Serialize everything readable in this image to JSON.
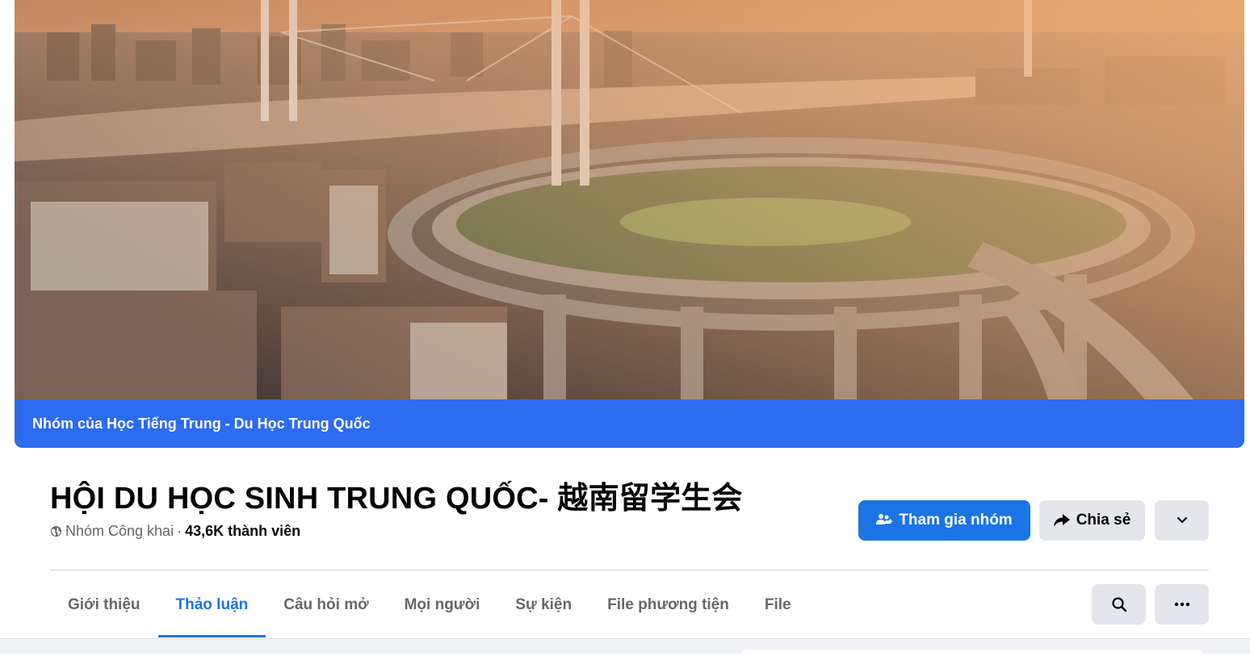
{
  "cover": {
    "banner_text": "Nhóm của Học Tiếng Trung - Du Học Trung Quốc",
    "banner_color": "#2d6bf0"
  },
  "group": {
    "title": "HỘI DU HỌC SINH TRUNG QUỐC- 越南留学生会",
    "privacy": "Nhóm Công khai",
    "separator": "·",
    "members": "43,6K thành viên"
  },
  "actions": {
    "join_label": "Tham gia nhóm",
    "share_label": "Chia sẻ",
    "join_color": "#1b74e4"
  },
  "tabs": [
    {
      "label": "Giới thiệu",
      "active": false
    },
    {
      "label": "Thảo luận",
      "active": true
    },
    {
      "label": "Câu hỏi mở",
      "active": false
    },
    {
      "label": "Mọi người",
      "active": false
    },
    {
      "label": "Sự kiện",
      "active": false
    },
    {
      "label": "File phương tiện",
      "active": false
    },
    {
      "label": "File",
      "active": false
    }
  ],
  "icons": {
    "privacy": "globe-icon",
    "join": "group-add-icon",
    "share": "share-arrow-icon",
    "more": "chevron-down-icon",
    "search": "search-icon",
    "tabs_more": "more-dots-icon"
  }
}
